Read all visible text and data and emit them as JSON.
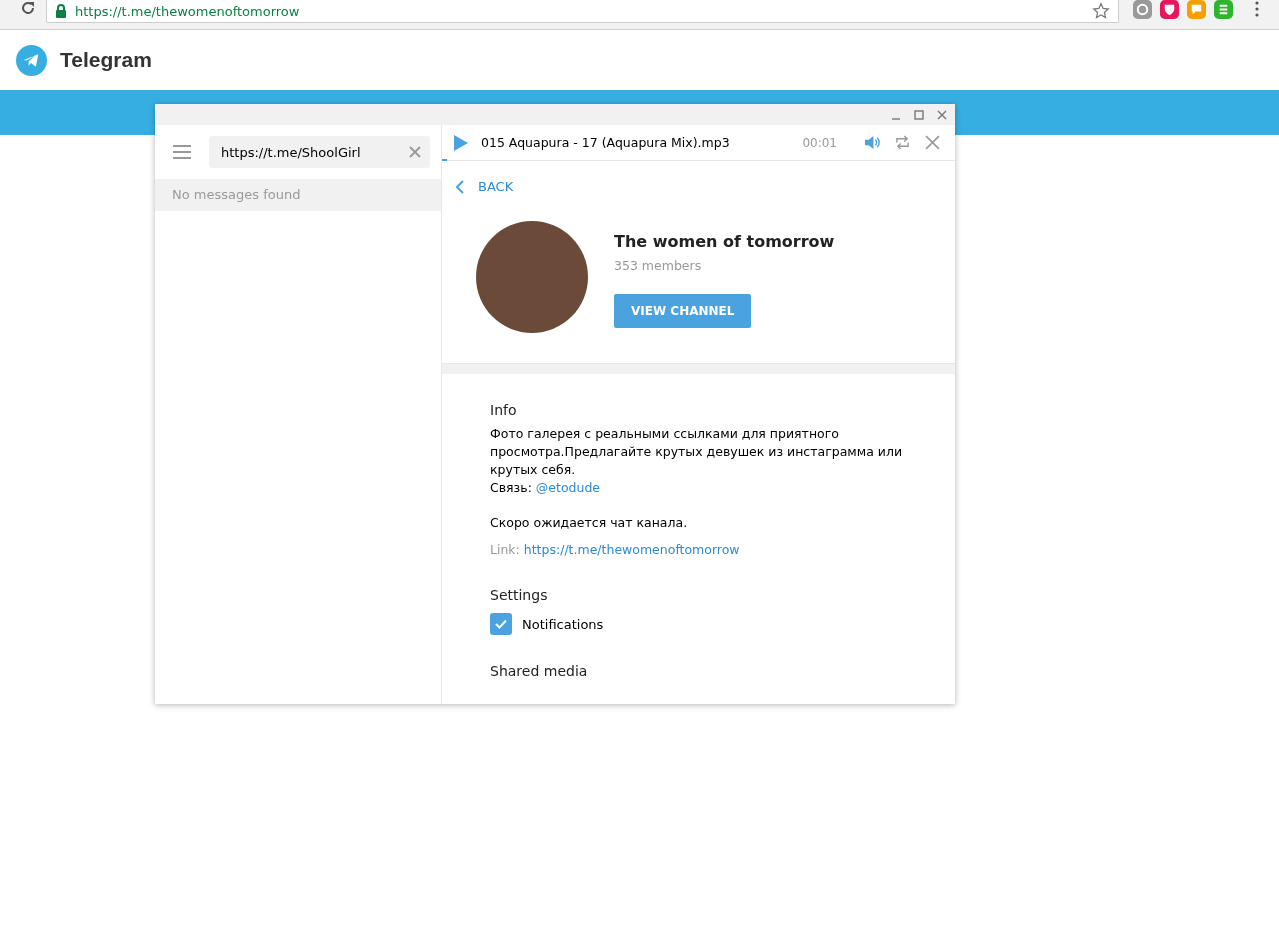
{
  "browser": {
    "url": "https://t.me/thewomenoftomorrow"
  },
  "site_header": {
    "title": "Telegram"
  },
  "search": {
    "value": "https://t.me/ShoolGirl"
  },
  "results": {
    "empty_text": "No messages found"
  },
  "player": {
    "track": "015 Aquapura - 17 (Aquapura Mix).mp3",
    "time": "00:01",
    "level": 0.01
  },
  "back": {
    "label": "BACK"
  },
  "channel": {
    "name": "The women of tomorrow",
    "members": "353 members",
    "button": "VIEW CHANNEL"
  },
  "info": {
    "heading": "Info",
    "text": "Фото галерея с реальными ссылками для приятного просмотра.Предлагайте крутых девушек из инстаграмма или крутых себя.",
    "contact_label": "Связь:",
    "contact_handle": "@etodude",
    "note": "Скоро ожидается чат канала.",
    "link_label": "Link:",
    "link_url": "https://t.me/thewomenoftomorrow"
  },
  "settings": {
    "heading": "Settings",
    "items": [
      {
        "label": "Notifications",
        "checked": true
      }
    ]
  },
  "shared_media": {
    "heading": "Shared media"
  }
}
